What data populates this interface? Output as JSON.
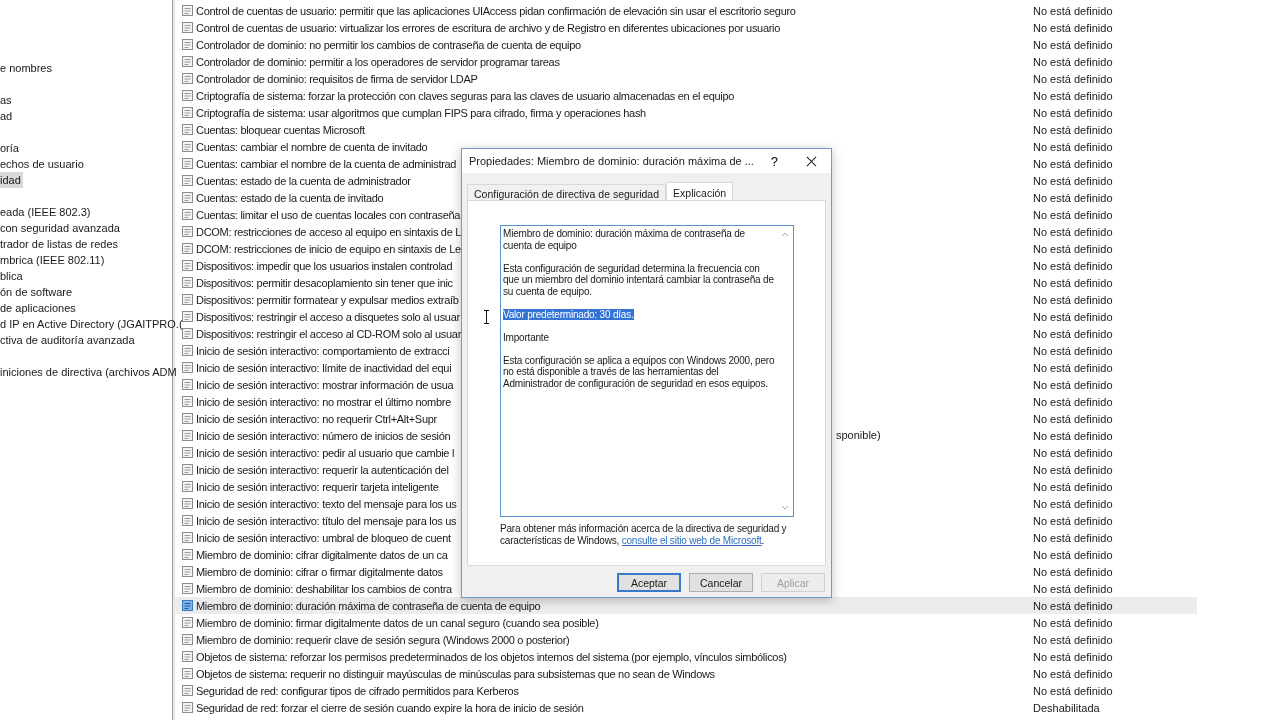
{
  "tree": {
    "groups": [
      [
        {
          "label": "e nombres",
          "selected": false
        }
      ],
      [
        {
          "label": "as",
          "selected": false
        },
        {
          "label": "ad",
          "selected": false
        }
      ],
      [
        {
          "label": "oría",
          "selected": false
        },
        {
          "label": "echos de usuario",
          "selected": false
        },
        {
          "label": "idad",
          "selected": true
        }
      ],
      [
        {
          "label": "eada (IEEE 802.3)",
          "selected": false
        },
        {
          "label": "con seguridad avanzada",
          "selected": false
        },
        {
          "label": "trador de listas de redes",
          "selected": false
        },
        {
          "label": "mbrica (IEEE 802.11)",
          "selected": false
        },
        {
          "label": "blica",
          "selected": false
        },
        {
          "label": "ón de software",
          "selected": false
        },
        {
          "label": "de aplicaciones",
          "selected": false
        },
        {
          "label": "d IP en Active Directory (JGAITPRO.(",
          "selected": false
        },
        {
          "label": "ctiva de auditoría avanzada",
          "selected": false
        }
      ],
      [
        {
          "label": "iniciones de directiva (archivos ADM",
          "selected": false
        }
      ]
    ]
  },
  "policy_list": {
    "rows": [
      {
        "name": "Control de cuentas de usuario: permitir que las aplicaciones UIAccess pidan confirmación de elevación sin usar el escritorio seguro",
        "setting": "No está definido",
        "selected": false
      },
      {
        "name": "Control de cuentas de usuario: virtualizar los errores de escritura de archivo y de Registro en diferentes ubicaciones por usuario",
        "setting": "No está definido",
        "selected": false
      },
      {
        "name": "Controlador de dominio: no permitir los cambios de contraseña de cuenta de equipo",
        "setting": "No está definido",
        "selected": false
      },
      {
        "name": "Controlador de dominio: permitir a los operadores de servidor programar tareas",
        "setting": "No está definido",
        "selected": false
      },
      {
        "name": "Controlador de dominio: requisitos de firma de servidor LDAP",
        "setting": "No está definido",
        "selected": false
      },
      {
        "name": "Criptografía de sistema: forzar la protección con claves seguras para las claves de usuario almacenadas en el equipo",
        "setting": "No está definido",
        "selected": false
      },
      {
        "name": "Criptografía de sistema: usar algoritmos que cumplan FIPS para cifrado, firma y operaciones hash",
        "setting": "No está definido",
        "selected": false
      },
      {
        "name": "Cuentas: bloquear cuentas Microsoft",
        "setting": "No está definido",
        "selected": false
      },
      {
        "name": "Cuentas: cambiar el nombre de cuenta de invitado",
        "setting": "No está definido",
        "selected": false
      },
      {
        "name": "Cuentas: cambiar el nombre de la cuenta de administrad",
        "setting": "No está definido",
        "selected": false
      },
      {
        "name": "Cuentas: estado de la cuenta de administrador",
        "setting": "No está definido",
        "selected": false
      },
      {
        "name": "Cuentas: estado de la cuenta de invitado",
        "setting": "No está definido",
        "selected": false
      },
      {
        "name": "Cuentas: limitar el uso de cuentas locales con contraseña",
        "setting": "No está definido",
        "selected": false
      },
      {
        "name": "DCOM: restricciones de acceso al equipo en sintaxis de L",
        "setting": "No está definido",
        "selected": false
      },
      {
        "name": "DCOM: restricciones de inicio de equipo en sintaxis de Le",
        "setting": "No está definido",
        "selected": false
      },
      {
        "name": "Dispositivos: impedir que los usuarios instalen controlad",
        "setting": "No está definido",
        "selected": false
      },
      {
        "name": "Dispositivos: permitir desacoplamiento sin tener que inic",
        "setting": "No está definido",
        "selected": false
      },
      {
        "name": "Dispositivos: permitir formatear y expulsar medios extraíb",
        "setting": "No está definido",
        "selected": false
      },
      {
        "name": "Dispositivos: restringir el acceso a disquetes solo al usuar",
        "setting": "No está definido",
        "selected": false
      },
      {
        "name": "Dispositivos: restringir el acceso al CD-ROM solo al usuar",
        "setting": "No está definido",
        "selected": false
      },
      {
        "name": "Inicio de sesión interactivo: comportamiento de extracci",
        "setting": "No está definido",
        "selected": false
      },
      {
        "name": "Inicio de sesión interactivo: límite de inactividad del equi",
        "setting": "No está definido",
        "selected": false
      },
      {
        "name": "Inicio de sesión interactivo: mostrar información de usua",
        "setting": "No está definido",
        "selected": false
      },
      {
        "name": "Inicio de sesión interactivo: no mostrar el último nombre",
        "setting": "No está definido",
        "selected": false
      },
      {
        "name": "Inicio de sesión interactivo: no requerir Ctrl+Alt+Supr",
        "setting": "No está definido",
        "selected": false
      },
      {
        "name": "Inicio de sesión interactivo: número de inicios de sesión",
        "tail": "sponible)",
        "setting": "No está definido",
        "selected": false
      },
      {
        "name": "Inicio de sesión interactivo: pedir al usuario que cambie l",
        "setting": "No está definido",
        "selected": false
      },
      {
        "name": "Inicio de sesión interactivo: requerir la autenticación del",
        "setting": "No está definido",
        "selected": false
      },
      {
        "name": "Inicio de sesión interactivo: requerir tarjeta inteligente",
        "setting": "No está definido",
        "selected": false
      },
      {
        "name": "Inicio de sesión interactivo: texto del mensaje para los us",
        "setting": "No está definido",
        "selected": false
      },
      {
        "name": "Inicio de sesión interactivo: título del mensaje para los us",
        "setting": "No está definido",
        "selected": false
      },
      {
        "name": "Inicio de sesión interactivo: umbral de bloqueo de cuent",
        "setting": "No está definido",
        "selected": false
      },
      {
        "name": "Miembro de dominio: cifrar digitalmente datos de un ca",
        "setting": "No está definido",
        "selected": false
      },
      {
        "name": "Miembro de dominio: cifrar o firmar digitalmente datos",
        "setting": "No está definido",
        "selected": false
      },
      {
        "name": "Miembro de dominio: deshabilitar los cambios de contra",
        "setting": "No está definido",
        "selected": false
      },
      {
        "name": "Miembro de dominio: duración máxima de contraseña de cuenta de equipo",
        "setting": "No está definido",
        "selected": true
      },
      {
        "name": "Miembro de dominio: firmar digitalmente datos de un canal seguro (cuando sea posible)",
        "setting": "No está definido",
        "selected": false
      },
      {
        "name": "Miembro de dominio: requerir clave de sesión segura (Windows 2000 o posterior)",
        "setting": "No está definido",
        "selected": false
      },
      {
        "name": "Objetos de sistema: reforzar los permisos predeterminados de los objetos internos del sistema (por ejemplo, vínculos simbólicos)",
        "setting": "No está definido",
        "selected": false
      },
      {
        "name": "Objetos de sistema: requerir no distinguir mayúsculas de minúsculas para subsistemas que no sean de Windows",
        "setting": "No está definido",
        "selected": false
      },
      {
        "name": "Seguridad de red: configurar tipos de cifrado permitidos para Kerberos",
        "setting": "No está definido",
        "selected": false
      },
      {
        "name": "Seguridad de red: forzar el cierre de sesión cuando expire la hora de inicio de sesión",
        "setting": "Deshabilitada",
        "selected": false
      }
    ]
  },
  "dialog": {
    "title": "Propiedades: Miembro de dominio: duración máxima de ...",
    "help": "?",
    "tabs": [
      {
        "label": "Configuración de directiva de seguridad",
        "selected": false
      },
      {
        "label": "Explicación",
        "selected": true
      }
    ],
    "explanation": [
      {
        "text": "Miembro de dominio: duración máxima de contraseña de cuenta de equipo",
        "selected": false
      },
      {
        "text": "Esta configuración de seguridad determina la frecuencia con que un miembro del dominio intentará cambiar la contraseña de su cuenta de equipo.",
        "selected": false
      },
      {
        "text": "Valor predeterminado: 30 días.",
        "selected": true
      },
      {
        "text": "Importante",
        "selected": false
      },
      {
        "text": "Esta configuración se aplica a equipos con Windows 2000, pero no está disponible a través de las herramientas del Administrador de configuración de seguridad en esos equipos.",
        "selected": false
      }
    ],
    "footer": {
      "text": "Para obtener más información acerca de la directiva de seguridad y características de Windows,",
      "link": "consulte el sitio web de Microsoft",
      "after": "."
    },
    "buttons": [
      {
        "label": "Aceptar",
        "default": true,
        "disabled": false
      },
      {
        "label": "Cancelar",
        "default": false,
        "disabled": false
      },
      {
        "label": "Aplicar",
        "default": false,
        "disabled": true
      }
    ]
  }
}
